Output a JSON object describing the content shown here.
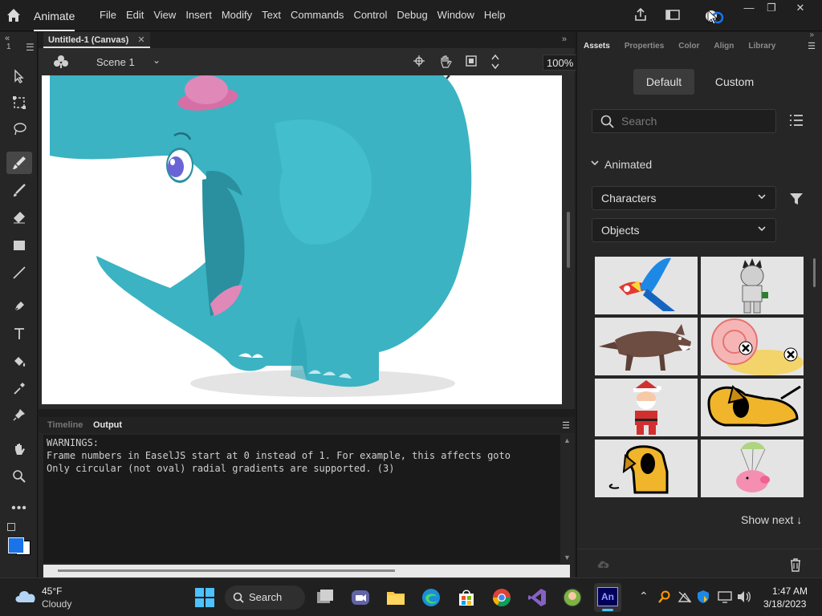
{
  "app": {
    "name": "Animate",
    "menus": [
      "File",
      "Edit",
      "View",
      "Insert",
      "Modify",
      "Text",
      "Commands",
      "Control",
      "Debug",
      "Window",
      "Help"
    ]
  },
  "toolbar": {
    "frame_number": "1"
  },
  "document": {
    "tab_title": "Untitled-1 (Canvas)",
    "scene": "Scene 1",
    "zoom": "100%"
  },
  "bottom_panel": {
    "tabs": [
      "Timeline",
      "Output"
    ],
    "active_tab": "Output",
    "output_lines": [
      "WARNINGS:",
      "Frame numbers in EaselJS start at 0 instead of 1. For example, this affects goto",
      "Only circular (not oval) radial gradients are supported. (3)"
    ]
  },
  "right_panel": {
    "tabs": [
      "Assets",
      "Properties",
      "Color",
      "Align",
      "Library"
    ],
    "active_tab": "Assets",
    "segments": [
      "Default",
      "Custom"
    ],
    "search_placeholder": "Search",
    "section": "Animated",
    "filters": [
      "Characters",
      "Objects"
    ],
    "show_next": "Show next ↓"
  },
  "taskbar": {
    "weather_temp": "45°F",
    "weather_desc": "Cloudy",
    "search_label": "Search",
    "time": "1:47 AM",
    "date": "3/18/2023"
  },
  "colors": {
    "elephant": "#3bb3c3",
    "elephant_dark": "#2a8f9e",
    "accent_blue": "#1a73e8",
    "hat_pink": "#e088b8"
  }
}
